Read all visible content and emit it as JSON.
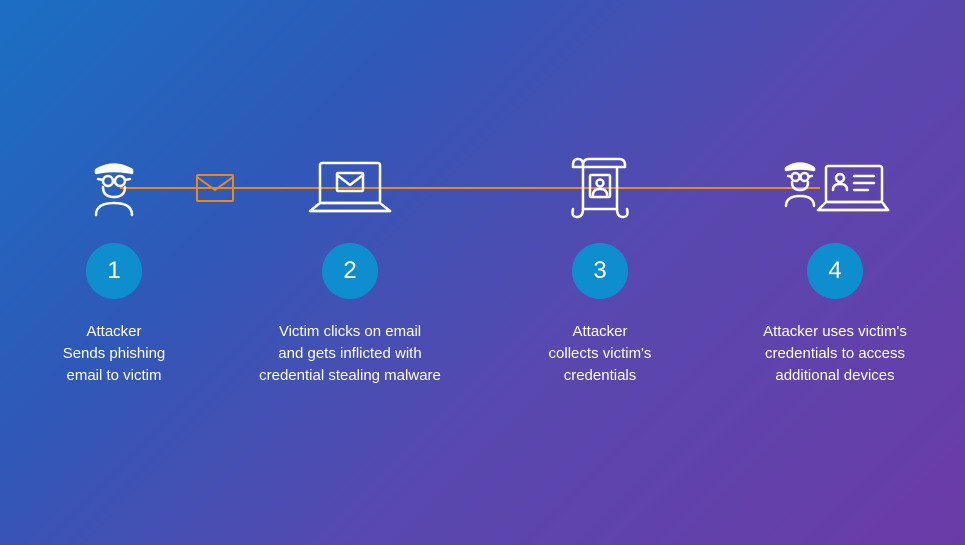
{
  "colors": {
    "accent": "#0f8ecf",
    "line": "#e8891a",
    "icon": "#ffffff"
  },
  "steps": [
    {
      "number": "1",
      "caption": "Attacker\nSends phishing\nemail to victim",
      "icon": "attacker-icon"
    },
    {
      "number": "2",
      "caption": "Victim clicks on email\nand gets inflicted with\ncredential stealing malware",
      "icon": "laptop-email-icon"
    },
    {
      "number": "3",
      "caption": "Attacker\ncollects victim's\ncredentials",
      "icon": "scroll-profile-icon"
    },
    {
      "number": "4",
      "caption": "Attacker uses victim's\ncredentials to access\nadditional devices",
      "icon": "attacker-laptop-icon"
    }
  ],
  "connector_icon": "envelope-icon"
}
